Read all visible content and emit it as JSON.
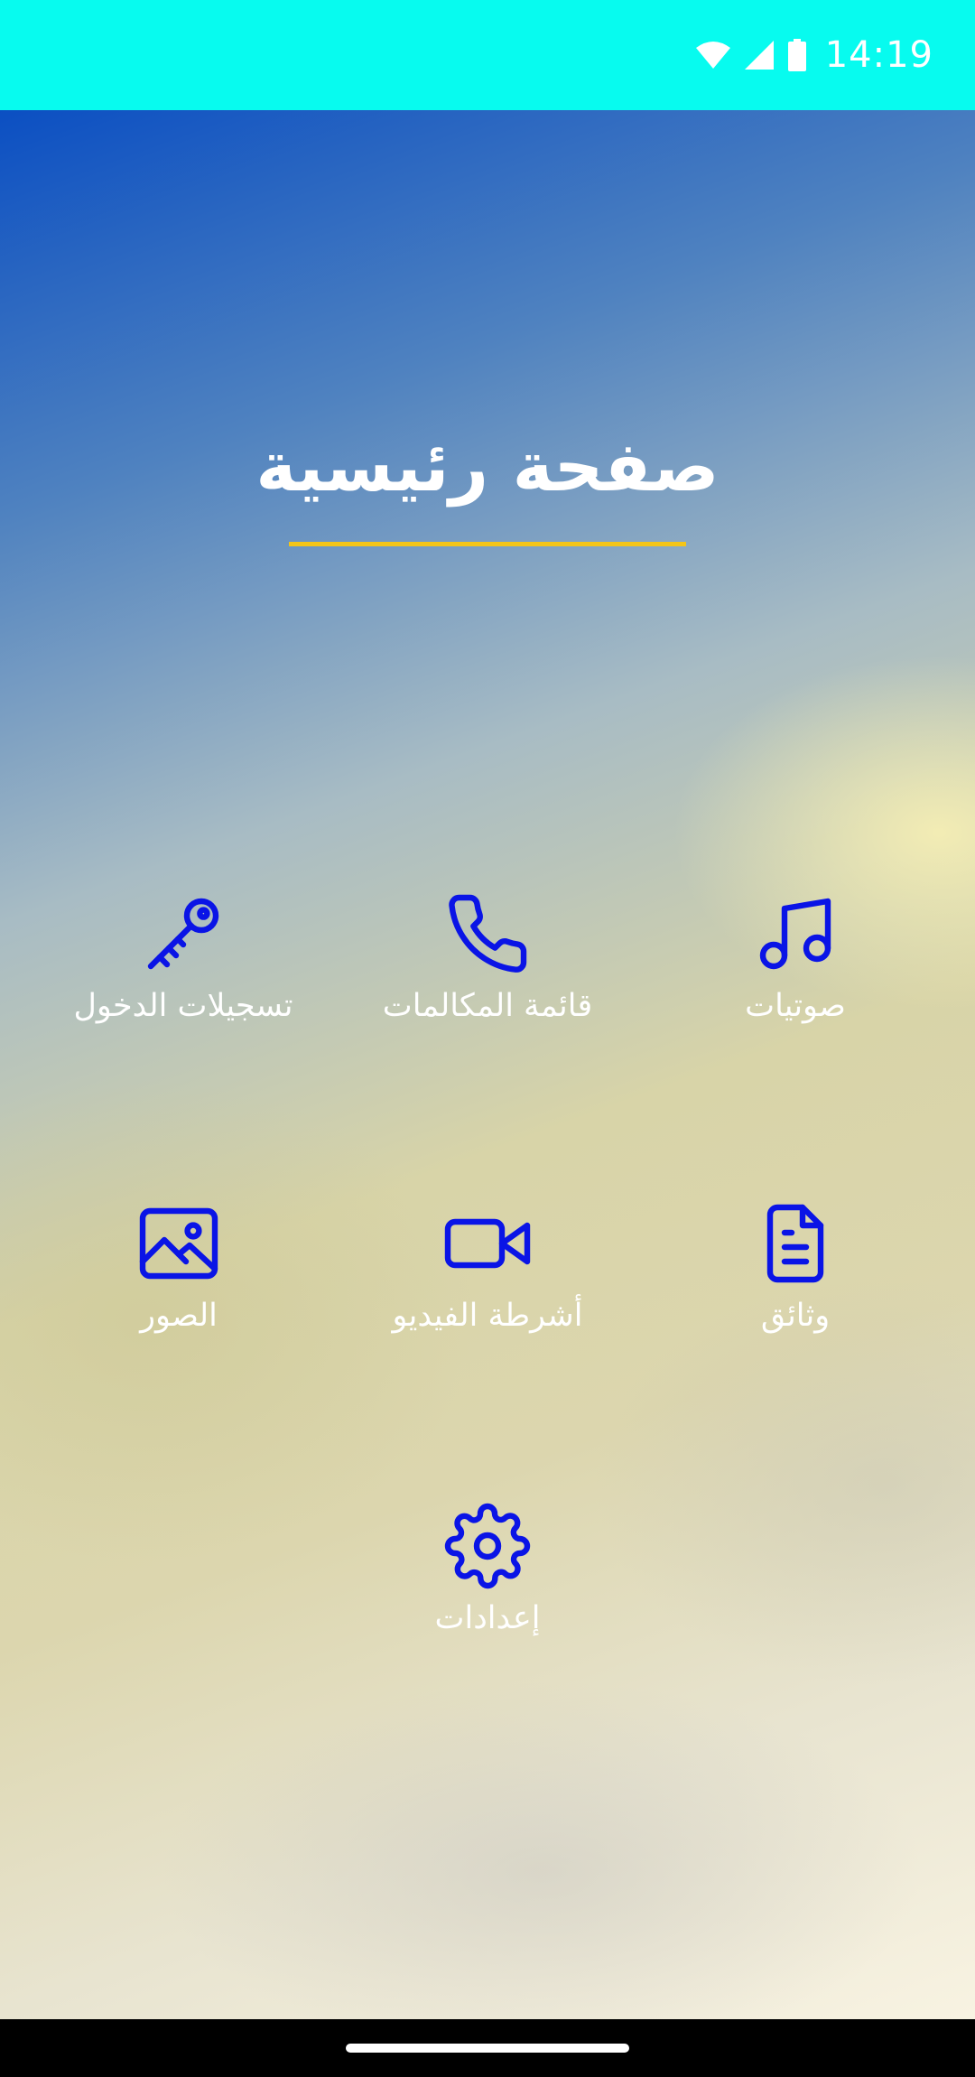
{
  "status_bar": {
    "time": "14:19",
    "background": "#07fbef",
    "icons": [
      "wifi-icon",
      "cell-signal-icon",
      "battery-icon"
    ]
  },
  "page": {
    "title": "صفحة رئيسية",
    "underline_color": "#f4c518",
    "icon_color": "#0a14e6"
  },
  "tiles": [
    {
      "label": "صوتيات",
      "icon": "music-note-icon"
    },
    {
      "label": "قائمة المكالمات",
      "icon": "phone-icon"
    },
    {
      "label": "تسجيلات الدخول",
      "icon": "key-icon"
    },
    {
      "label": "وثائق",
      "icon": "document-icon"
    },
    {
      "label": "أشرطة الفيديو",
      "icon": "video-camera-icon"
    },
    {
      "label": "الصور",
      "icon": "image-icon"
    },
    {
      "label": "إعدادات",
      "icon": "gear-icon"
    }
  ]
}
